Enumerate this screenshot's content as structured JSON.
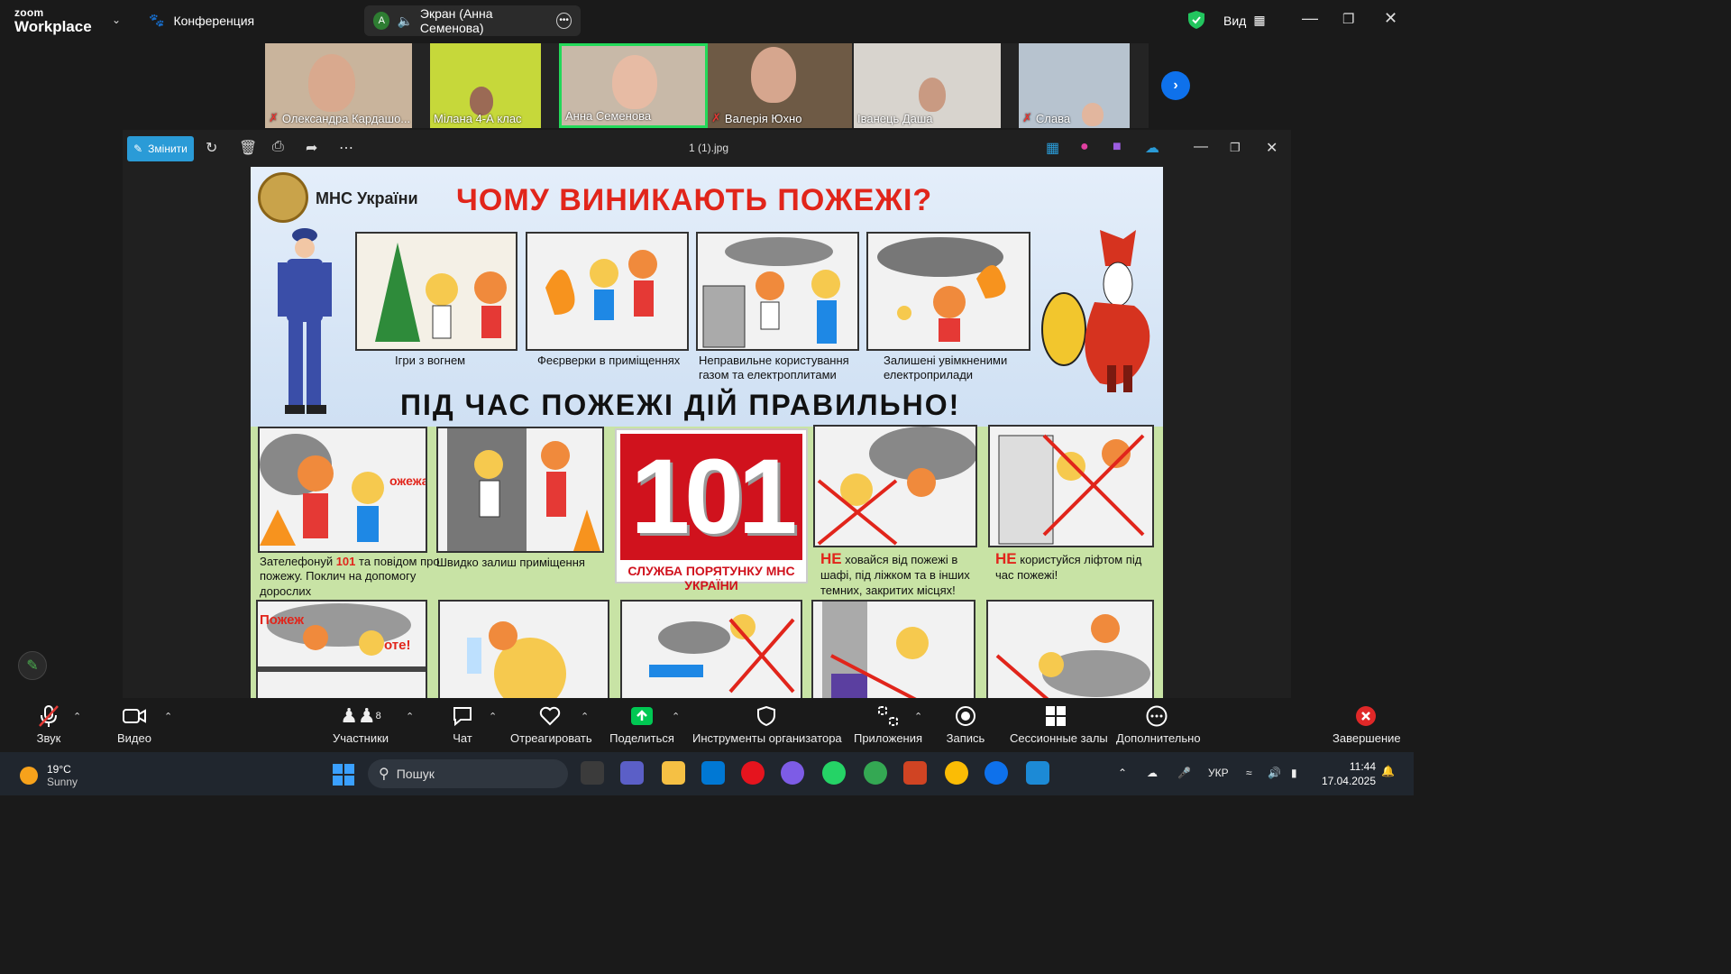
{
  "app": {
    "logo_line1": "zoom",
    "logo_line2": "Workplace"
  },
  "header": {
    "meeting_label": "Конференция",
    "share_pill": {
      "avatar_letter": "A",
      "label": "Экран (Анна Семенова)"
    },
    "view_label": "Вид"
  },
  "participants": [
    {
      "name": "Олександра Кардашо...",
      "muted": true
    },
    {
      "name": "Мілана 4-А клас",
      "muted": false
    },
    {
      "name": "Анна Семенова",
      "muted": false,
      "active": true
    },
    {
      "name": "Валерія Юхно",
      "muted": true
    },
    {
      "name": "Іванець Даша",
      "muted": false
    },
    {
      "name": "Слава",
      "muted": true
    }
  ],
  "viewer": {
    "edit_label": "Змінити",
    "file_name": "1 (1).jpg"
  },
  "poster": {
    "org": "МНС України",
    "title": "ЧОМУ ВИНИКАЮТЬ ПОЖЕЖІ?",
    "causes": [
      "Ігри з вогнем",
      "Феєрверки в приміщеннях",
      "Неправильне користування газом та електроплитами",
      "Залишені увімкненими електроприлади"
    ],
    "subtitle": "ПІД ЧАС ПОЖЕЖІ ДІЙ ПРАВИЛЬНО!",
    "emergency_number": "101",
    "service_label": "СЛУЖБА ПОРЯТУНКУ МНС УКРАЇНИ",
    "rule1": {
      "a": "Зателефонуй ",
      "b": "101",
      "c": " та повідом про пожежу. Поклич на допомогу дорослих"
    },
    "rule2": "Швидко залиш приміщення",
    "rule3": {
      "ne": "НЕ",
      "text": " ховайся від пожежі в шафі, під ліжком та в інших темних, закритих місцях!"
    },
    "rule4": {
      "ne": "НЕ",
      "text": " користуйся ліфтом під час пожежі!"
    },
    "bubble1": "ожежа!",
    "bubble2": "Пожеж",
    "bubble3": "оте!"
  },
  "controls": {
    "audio": "Звук",
    "video": "Видео",
    "participants": "Участники",
    "participants_count": "8",
    "chat": "Чат",
    "react": "Отреагировать",
    "share": "Поделиться",
    "host_tools": "Инструменты организатора",
    "apps": "Приложения",
    "record": "Запись",
    "breakout": "Сессионные залы",
    "more": "Дополнительно",
    "end": "Завершение"
  },
  "taskbar": {
    "temp": "19°C",
    "weather": "Sunny",
    "search_placeholder": "Пошук",
    "lang": "УКР",
    "time": "11:44",
    "date": "17.04.2025"
  },
  "colors": {
    "zoom_blue": "#0e71eb",
    "active_green": "#23d959",
    "share_green": "#00c853",
    "end_red": "#e02828"
  }
}
